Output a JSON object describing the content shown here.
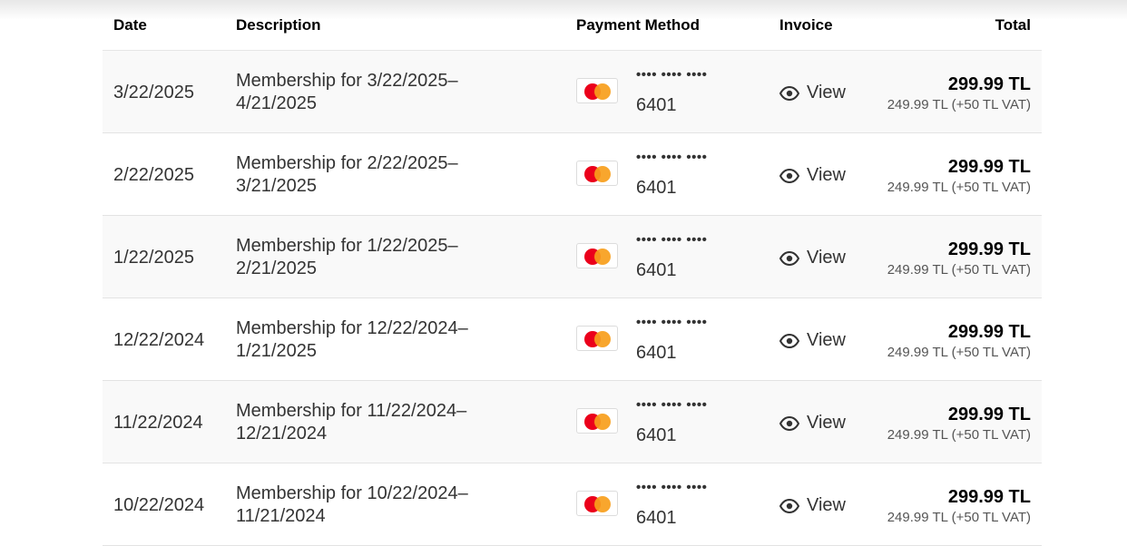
{
  "headers": {
    "date": "Date",
    "description": "Description",
    "payment_method": "Payment Method",
    "invoice": "Invoice",
    "total": "Total"
  },
  "rows": [
    {
      "date": "3/22/2025",
      "description": "Membership for 3/22/2025–4/21/2025",
      "card_mask": "•••• •••• ••••",
      "card_last4": "6401",
      "invoice_label": "View",
      "total": "299.99 TL",
      "total_breakdown": "249.99 TL (+50 TL VAT)"
    },
    {
      "date": "2/22/2025",
      "description": "Membership for 2/22/2025–3/21/2025",
      "card_mask": "•••• •••• ••••",
      "card_last4": "6401",
      "invoice_label": "View",
      "total": "299.99 TL",
      "total_breakdown": "249.99 TL (+50 TL VAT)"
    },
    {
      "date": "1/22/2025",
      "description": "Membership for 1/22/2025–2/21/2025",
      "card_mask": "•••• •••• ••••",
      "card_last4": "6401",
      "invoice_label": "View",
      "total": "299.99 TL",
      "total_breakdown": "249.99 TL (+50 TL VAT)"
    },
    {
      "date": "12/22/2024",
      "description": "Membership for 12/22/2024–1/21/2025",
      "card_mask": "•••• •••• ••••",
      "card_last4": "6401",
      "invoice_label": "View",
      "total": "299.99 TL",
      "total_breakdown": "249.99 TL (+50 TL VAT)"
    },
    {
      "date": "11/22/2024",
      "description": "Membership for 11/22/2024–12/21/2024",
      "card_mask": "•••• •••• ••••",
      "card_last4": "6401",
      "invoice_label": "View",
      "total": "299.99 TL",
      "total_breakdown": "249.99 TL (+50 TL VAT)"
    },
    {
      "date": "10/22/2024",
      "description": "Membership for 10/22/2024–11/21/2024",
      "card_mask": "•••• •••• ••••",
      "card_last4": "6401",
      "invoice_label": "View",
      "total": "299.99 TL",
      "total_breakdown": "249.99 TL (+50 TL VAT)"
    }
  ],
  "icons": {
    "card_brand": "mastercard-icon",
    "invoice": "eye-icon"
  },
  "colors": {
    "mastercard_red": "#eb001b",
    "mastercard_yellow": "#f79e1b"
  }
}
